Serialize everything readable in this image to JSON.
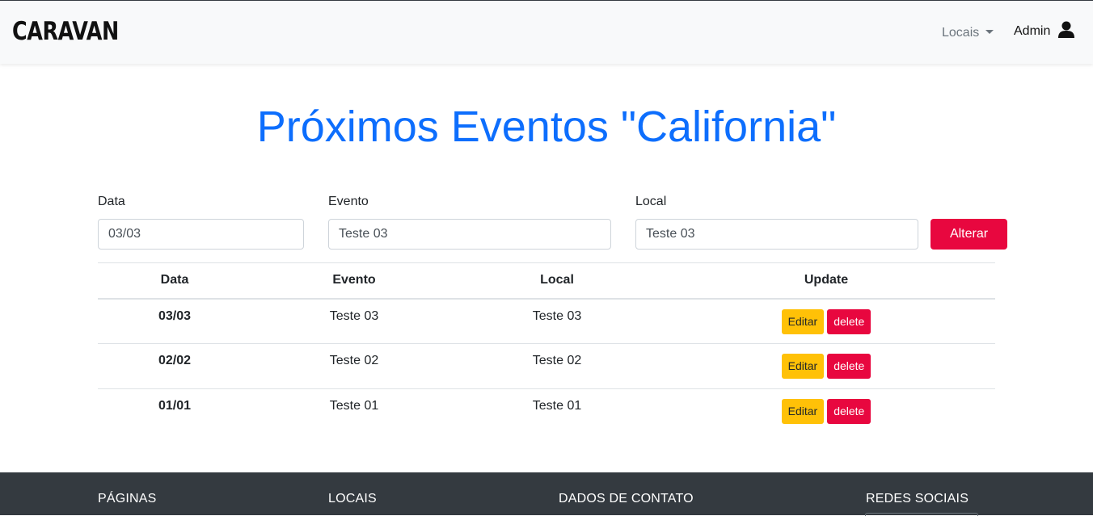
{
  "navbar": {
    "brand": "CARAVAN",
    "locais_label": "Locais",
    "admin_label": "Admin"
  },
  "page": {
    "title": "Próximos Eventos \"California\""
  },
  "form": {
    "data_label": "Data",
    "data_value": "03/03",
    "evento_label": "Evento",
    "evento_value": "Teste 03",
    "local_label": "Local",
    "local_value": "Teste 03",
    "submit_label": "Alterar"
  },
  "table": {
    "headers": [
      "Data",
      "Evento",
      "Local",
      "Update"
    ],
    "rows": [
      {
        "data": "03/03",
        "evento": "Teste 03",
        "local": "Teste 03"
      },
      {
        "data": "02/02",
        "evento": "Teste 02",
        "local": "Teste 02"
      },
      {
        "data": "01/01",
        "evento": "Teste 01",
        "local": "Teste 01"
      }
    ],
    "edit_label": "Editar",
    "delete_label": "delete"
  },
  "footer": {
    "headings": [
      "PÁGINAS",
      "LOCAIS",
      "DADOS DE CONTATO",
      "REDES SOCIAIS"
    ]
  },
  "colors": {
    "title_blue": "#0d6efd",
    "danger": "#e8073f",
    "warning": "#ffc107",
    "footer_bg": "#343a40"
  },
  "icons": {
    "user": "user-icon",
    "caret": "caret-down-icon"
  }
}
